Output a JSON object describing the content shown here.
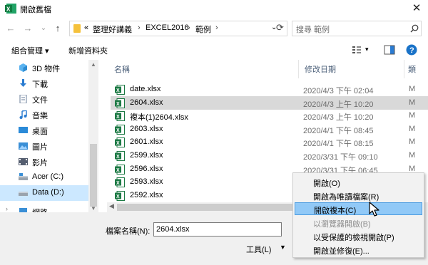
{
  "window": {
    "title": "開啟舊檔",
    "close_glyph": "✕"
  },
  "nav": {
    "back_glyph": "←",
    "forward_glyph": "→",
    "recent_glyph": "⌄",
    "up_glyph": "↑",
    "breadcrumb_prefix": "«",
    "breadcrumb": [
      "整理好講義",
      "EXCEL2016",
      "範例"
    ],
    "separator": "›",
    "dropdown_glyph": "⌄",
    "refresh_glyph": "⟳",
    "search_placeholder": "搜尋 範例"
  },
  "toolbar": {
    "organize": "組合管理 ▾",
    "new_folder": "新增資料夾",
    "help_glyph": "?"
  },
  "sidebar": {
    "items": [
      {
        "label": "3D 物件",
        "icon": "3d-objects-icon"
      },
      {
        "label": "下載",
        "icon": "download-icon"
      },
      {
        "label": "文件",
        "icon": "document-icon"
      },
      {
        "label": "音樂",
        "icon": "music-icon"
      },
      {
        "label": "桌面",
        "icon": "desktop-icon"
      },
      {
        "label": "圖片",
        "icon": "pictures-icon"
      },
      {
        "label": "影片",
        "icon": "videos-icon"
      },
      {
        "label": "Acer (C:)",
        "icon": "drive-icon"
      },
      {
        "label": "Data (D:)",
        "icon": "drive-icon",
        "selected": true
      },
      {
        "label": "網路",
        "icon": "network-icon"
      }
    ]
  },
  "columns": {
    "name": "名稱",
    "modified": "修改日期",
    "type": "類"
  },
  "files": [
    {
      "name": "date.xlsx",
      "modified": "2020/4/3 下午 02:04",
      "type": "M"
    },
    {
      "name": "2604.xlsx",
      "modified": "2020/4/3 上午 10:20",
      "type": "M",
      "selected": true
    },
    {
      "name": "複本(1)2604.xlsx",
      "modified": "2020/4/3 上午 10:20",
      "type": "M"
    },
    {
      "name": "2603.xlsx",
      "modified": "2020/4/1 下午 08:45",
      "type": "M"
    },
    {
      "name": "2601.xlsx",
      "modified": "2020/4/1 下午 08:15",
      "type": "M"
    },
    {
      "name": "2599.xlsx",
      "modified": "2020/3/31 下午 09:10",
      "type": "M"
    },
    {
      "name": "2596.xlsx",
      "modified": "2020/3/31 下午 06:45",
      "type": "M"
    },
    {
      "name": "2593.xlsx",
      "modified": "",
      "type": ""
    },
    {
      "name": "2592.xlsx",
      "modified": "",
      "type": ""
    }
  ],
  "footer": {
    "filename_label": "檔案名稱(N):",
    "filename_value": "2604.xlsx",
    "tools_label": "工具(L)",
    "tools_dropdown_glyph": "▼"
  },
  "open_menu": {
    "items": [
      {
        "label": "開啟(O)",
        "state": "normal"
      },
      {
        "label": "開啟為唯讀檔案(R)",
        "state": "normal"
      },
      {
        "label": "開啟複本(C)",
        "state": "highlighted"
      },
      {
        "label": "以瀏覽器開啟(B)",
        "state": "disabled"
      },
      {
        "label": "以受保護的檢視開啟(P)",
        "state": "normal"
      },
      {
        "label": "開啟並修復(E)...",
        "state": "normal"
      }
    ]
  },
  "colors": {
    "selection": "#cce8ff",
    "row_selected": "#d9d9d9",
    "menu_highlight": "#91c9f7",
    "excel_green": "#1d7a45",
    "help_blue": "#1a73c8"
  }
}
